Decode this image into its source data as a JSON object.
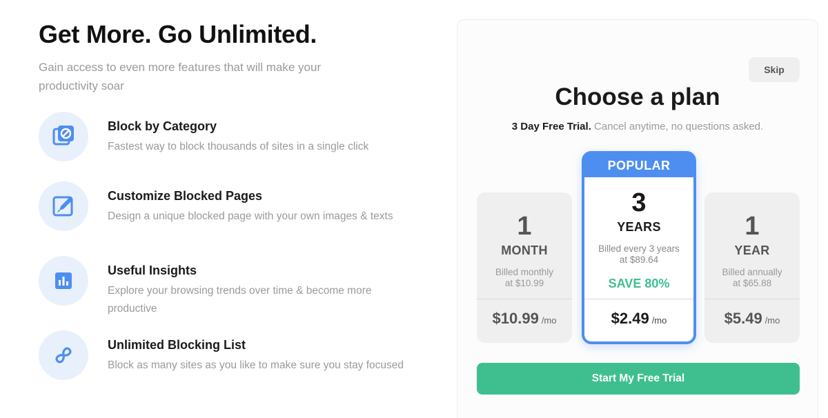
{
  "left": {
    "headline": "Get More. Go Unlimited.",
    "subline": "Gain access to even more features that will make your productivity soar",
    "features": [
      {
        "icon": "block-category-icon",
        "title": "Block by Category",
        "desc": "Fastest way to block thousands of sites in a single click"
      },
      {
        "icon": "edit-page-icon",
        "title": "Customize Blocked Pages",
        "desc": "Design a unique blocked page with your own images & texts"
      },
      {
        "icon": "chart-icon",
        "title": "Useful Insights",
        "desc": "Explore your browsing trends over time & become more productive"
      },
      {
        "icon": "infinity-icon",
        "title": "Unlimited Blocking List",
        "desc": "Block as many sites as you like to make sure you stay focused"
      }
    ]
  },
  "panel": {
    "skip_label": "Skip",
    "title": "Choose a plan",
    "trial_bold": "3 Day Free Trial.",
    "trial_rest": " Cancel anytime, no questions asked.",
    "plans": [
      {
        "num": "1",
        "unit": "MONTH",
        "billed_1": "Billed monthly",
        "billed_2": "at $10.99",
        "price": "$10.99",
        "per": "/mo"
      },
      {
        "badge": "POPULAR",
        "num": "3",
        "unit": "YEARS",
        "billed_1": "Billed every 3 years",
        "billed_2": "at $89.64",
        "save": "SAVE 80%",
        "price": "$2.49",
        "per": "/mo"
      },
      {
        "num": "1",
        "unit": "YEAR",
        "billed_1": "Billed annually",
        "billed_2": "at $65.88",
        "price": "$5.49",
        "per": "/mo"
      }
    ],
    "cta_label": "Start My Free Trial"
  },
  "colors": {
    "accent_blue": "#4e8ef0",
    "accent_green": "#3fbf8f",
    "icon_bg": "#e8f0fc"
  }
}
